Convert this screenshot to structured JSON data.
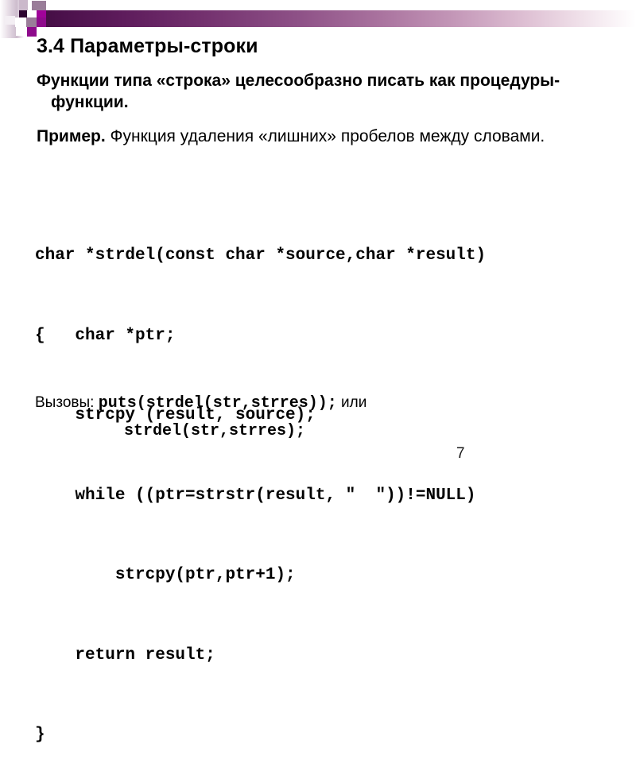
{
  "slide": {
    "title": "3.4 Параметры-строки",
    "page_number": "7"
  },
  "header": {
    "band_color_dark": "#3d0b3d",
    "band_color_light": "#ffffff",
    "squares": [
      {
        "name": "square-1",
        "color": "#cbb9cb"
      },
      {
        "name": "square-2",
        "color": "#9a6f99"
      },
      {
        "name": "square-3",
        "color": "#3d0b3d"
      },
      {
        "name": "square-4",
        "color": "#a0039a"
      },
      {
        "name": "square-5",
        "color": "#9a7d99"
      },
      {
        "name": "square-6",
        "color": "#8e0b8c"
      },
      {
        "name": "square-7",
        "color": "#4a104a"
      },
      {
        "name": "square-8",
        "color": "#8e0b8c"
      }
    ]
  },
  "body": {
    "intro": "Функции типа «строка» целесообразно писать как процедуры-функции.",
    "example_lead": "Пример.",
    "example_text": " Функция удаления «лишних» пробелов между словами."
  },
  "code": {
    "lines": [
      "char *strdel(const char *source,char *result)",
      "{   char *ptr;",
      "    strcpy (result, source);",
      "    while ((ptr=strstr(result, \"  \"))!=NULL)",
      "        strcpy(ptr,ptr+1);",
      "    return result;",
      "}"
    ]
  },
  "calls": {
    "label": "Вызовы: ",
    "call_1": "puts(strdel(str,strres));",
    "suffix": " или",
    "call_2": "strdel(str,strres);"
  }
}
